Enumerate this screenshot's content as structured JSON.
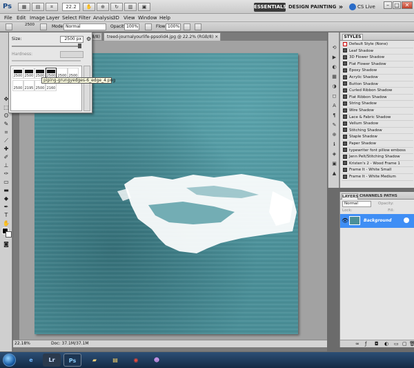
{
  "titlebar": {
    "app_logo": "Ps",
    "zoom_value": "22.2",
    "workspaces": [
      "ESSENTIALS",
      "DESIGN",
      "PAINTING"
    ],
    "more_symbol": "»",
    "cs_live": "CS Live"
  },
  "menu": [
    "File",
    "Edit",
    "Image",
    "Layer",
    "Select",
    "Filter",
    "Analysis",
    "3D",
    "View",
    "Window",
    "Help"
  ],
  "options": {
    "brush_size": "2500",
    "mode_label": "Mode:",
    "mode_value": "Normal",
    "opacity_label": "Opacity:",
    "opacity_value": "100%",
    "flow_label": "Flow:",
    "flow_value": "100%"
  },
  "brush_picker": {
    "size_label": "Size:",
    "size_value": "2500 px",
    "hardness_label": "Hardness:",
    "brush_sizes": [
      "2500",
      "2500",
      "2500",
      "2500",
      "2500",
      "2500",
      "2500",
      "2195",
      "2500",
      "2160",
      "",
      ""
    ],
    "tooltip": "piping-grungyedges-6_edge_4.png"
  },
  "document": {
    "tab_title": "treed-journalyourlife-ppsolid4.jpg @ 22.2% (RGB/8) ×",
    "prev_tab": "(8/8)",
    "zoom_status": "22.18%",
    "doc_status": "Doc: 37.1M/37.1M"
  },
  "styles_panel": {
    "tab": "STYLES",
    "items": [
      "Default Style (None)",
      "Leaf Shadow",
      "3D Flower Shadow",
      "Flat Flower Shadow",
      "Epoxy Shadow",
      "Acrylic Shadow",
      "Button Shadow",
      "Curled Ribbon Shadow",
      "Flat Ribbon Shadow",
      "String Shadow",
      "Wire Shadow",
      "Lace & Fabric Shadow",
      "Vellum Shadow",
      "Stitching Shadow",
      "Staple Shadow",
      "Paper Shadow",
      "typewriter font pillow emboss",
      "Jenn Pelt/Stitching Shadow",
      "Kristen's 2 - Wood Frame 1",
      "Frame It - White Small",
      "Frame It - White Medium"
    ]
  },
  "layers_panel": {
    "tabs": [
      "LAYERS",
      "CHANNELS",
      "PATHS"
    ],
    "blend_mode": "Normal",
    "opacity_label": "Opacity:",
    "lock_label": "Lock:",
    "fill_label": "Fill:",
    "layer_name": "Background"
  },
  "taskbar": {
    "apps": [
      "Lr",
      "Ps"
    ]
  },
  "colors": {
    "canvas": "#4a8f98",
    "selected_layer": "#3f8ef5",
    "foreground": "#000000",
    "background": "#ffffff"
  }
}
